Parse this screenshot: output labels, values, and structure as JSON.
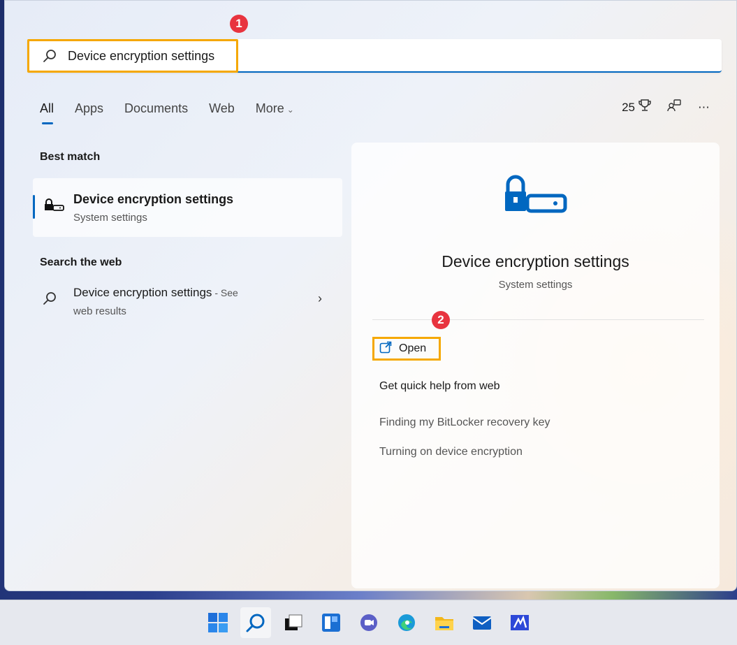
{
  "search": {
    "value": "Device encryption settings",
    "placeholder": ""
  },
  "badges": {
    "step1": "1",
    "step2": "2"
  },
  "tabs": [
    {
      "label": "All"
    },
    {
      "label": "Apps"
    },
    {
      "label": "Documents"
    },
    {
      "label": "Web"
    },
    {
      "label": "More"
    }
  ],
  "top_right": {
    "points": "25"
  },
  "left": {
    "best_match_title": "Best match",
    "best_match": {
      "title": "Device encryption settings",
      "subtitle": "System settings"
    },
    "search_web_title": "Search the web",
    "web_result": {
      "title": "Device encryption settings",
      "see": " - See",
      "subtitle": "web results"
    }
  },
  "right": {
    "title": "Device encryption settings",
    "subtitle": "System settings",
    "open_label": "Open",
    "help_title": "Get quick help from web",
    "links": [
      "Finding my BitLocker recovery key",
      "Turning on device encryption"
    ]
  },
  "colors": {
    "accent": "#0067c0",
    "highlight": "#f5a800",
    "badge": "#e8343f"
  },
  "icons": {
    "search": "search-icon",
    "lock_key": "device-encryption-icon",
    "open": "open-external-icon"
  },
  "taskbar": [
    "start-icon",
    "search-icon",
    "task-view-icon",
    "widgets-icon",
    "chat-icon",
    "edge-icon",
    "file-explorer-icon",
    "mail-icon",
    "store-icon"
  ]
}
